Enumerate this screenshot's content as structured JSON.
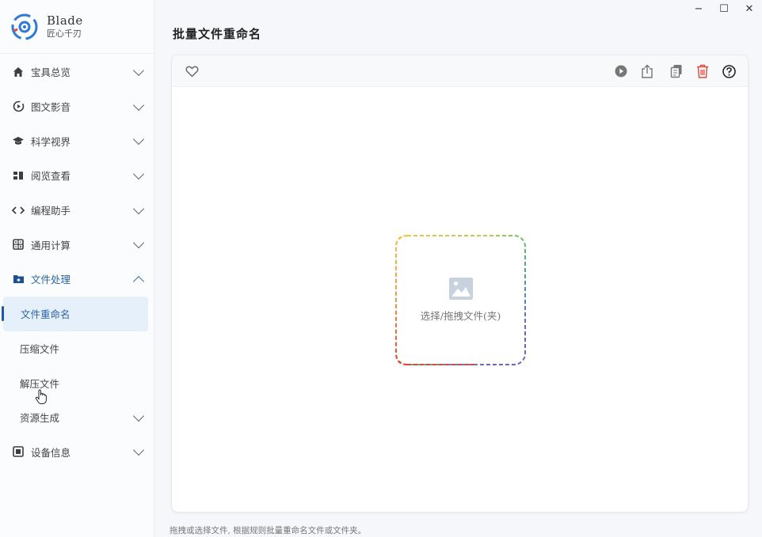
{
  "brand": {
    "name": "Blade",
    "subtitle": "匠心千刃"
  },
  "nav": {
    "items": [
      {
        "label": "宝具总览",
        "icon": "home-icon"
      },
      {
        "label": "图文影音",
        "icon": "media-icon"
      },
      {
        "label": "科学视界",
        "icon": "graduation-cap-icon"
      },
      {
        "label": "阅览查看",
        "icon": "layout-icon"
      },
      {
        "label": "编程助手",
        "icon": "code-icon"
      },
      {
        "label": "通用计算",
        "icon": "calculator-icon"
      },
      {
        "label": "文件处理",
        "icon": "folder-add-icon"
      }
    ],
    "sub_items": [
      "文件重命名",
      "压缩文件",
      "解压文件"
    ],
    "after_items": [
      {
        "label": "资源生成"
      },
      {
        "label": "设备信息",
        "icon": "chip-icon"
      }
    ]
  },
  "window": {
    "minimize": "−",
    "maximize": "☐",
    "close": "✕"
  },
  "page": {
    "title": "批量文件重命名"
  },
  "dropzone": {
    "text": "选择/拖拽文件(夹)"
  },
  "status": {
    "text": "拖拽或选择文件, 根据规则批量重命名文件或文件夹。"
  },
  "colors": {
    "accent": "#2a64ad",
    "delete": "#e24b3b",
    "active_bg": "#e6f0fb"
  }
}
